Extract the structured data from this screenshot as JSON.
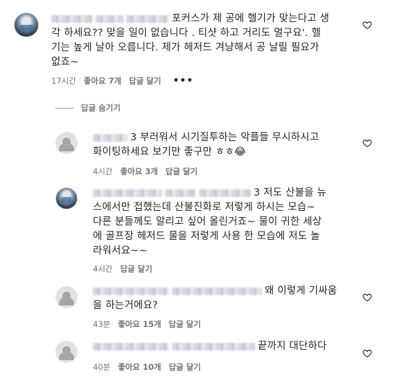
{
  "comments": [
    {
      "text_line1": "포커스가 제 공에 헬기가 맞는다고 생",
      "text_line2": "각 하세요?? 맞을 일이 없습니다 . 티샷 하고 거리도 멀구요'. 헬",
      "text_line3": "기는 높게 날아 오릅니다. 제가 헤저드 겨냥해서 공 날릴 필요가",
      "text_line4": "없죠~",
      "time": "17시간",
      "likes": "좋아요 7개",
      "reply": "답글 달기",
      "more": "•••"
    }
  ],
  "toggle_label": "답글 숨기기",
  "replies": [
    {
      "text_line1": "3 부러워서 시기질투하는 악플들 무시하시고",
      "text_line2": "화이팅하세요 보기만 좋구만 ㅎㅎ",
      "emoji": "😂",
      "time": "4시간",
      "likes": "좋아요 3개",
      "reply": "답글 달기"
    },
    {
      "text_line1": "3 저도 산불을 뉴",
      "text_line2": "스에서만 접했는데 산불진화로 저렇게 하시는 모습~",
      "text_line3": "다른 분들께도 알리고 싶어 올린거죠~ 물이 귀한 세상",
      "text_line4": "에 골프장 헤저드 물을 저렇게 사용 한 모습에 저도 놀",
      "text_line5": "라워서요~~",
      "time": "4시간",
      "reply": "답글 달기"
    },
    {
      "text_line1": "왜 이렇게 기싸움",
      "text_line2": "을 하는거에요?",
      "time": "43분",
      "likes": "좋아요 15개",
      "reply": "답글 달기"
    },
    {
      "text_line1": "끝까지 대단하다",
      "time": "40분",
      "likes": "좋아요 10개",
      "reply": "답글 달기"
    }
  ]
}
